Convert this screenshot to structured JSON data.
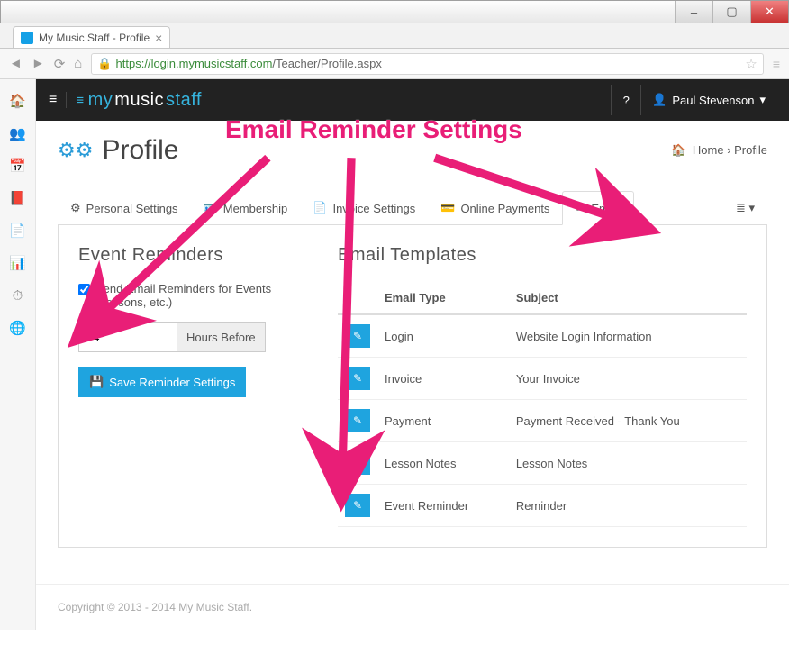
{
  "browser": {
    "tab_title": "My Music Staff - Profile",
    "url_host": "https://login.mymusicstaff.com",
    "url_path": "/Teacher/Profile.aspx"
  },
  "topbar": {
    "brand_my": "my",
    "brand_music": "music",
    "brand_staff": "staff",
    "help_icon": "?",
    "user_name": "Paul Stevenson"
  },
  "page": {
    "title": "Profile",
    "breadcrumb_home": "Home",
    "breadcrumb_current": "Profile"
  },
  "tabs": {
    "personal": "Personal Settings",
    "membership": "Membership",
    "invoice": "Invoice Settings",
    "payments": "Online Payments",
    "email": "Email"
  },
  "reminders": {
    "heading": "Event Reminders",
    "checkbox_label": "Send Email Reminders for Events (Lessons, etc.)",
    "hours_value": "24",
    "hours_addon": "Hours Before",
    "save_label": "Save Reminder Settings"
  },
  "templates": {
    "heading": "Email Templates",
    "col_type": "Email Type",
    "col_subject": "Subject",
    "rows": [
      {
        "type": "Login",
        "subject": "Website Login Information"
      },
      {
        "type": "Invoice",
        "subject": "Your Invoice"
      },
      {
        "type": "Payment",
        "subject": "Payment Received - Thank You"
      },
      {
        "type": "Lesson Notes",
        "subject": "Lesson Notes"
      },
      {
        "type": "Event Reminder",
        "subject": "Reminder"
      }
    ]
  },
  "footer": {
    "text": "Copyright © 2013 - 2014 My Music Staff."
  },
  "annotation": {
    "label": "Email Reminder Settings"
  }
}
